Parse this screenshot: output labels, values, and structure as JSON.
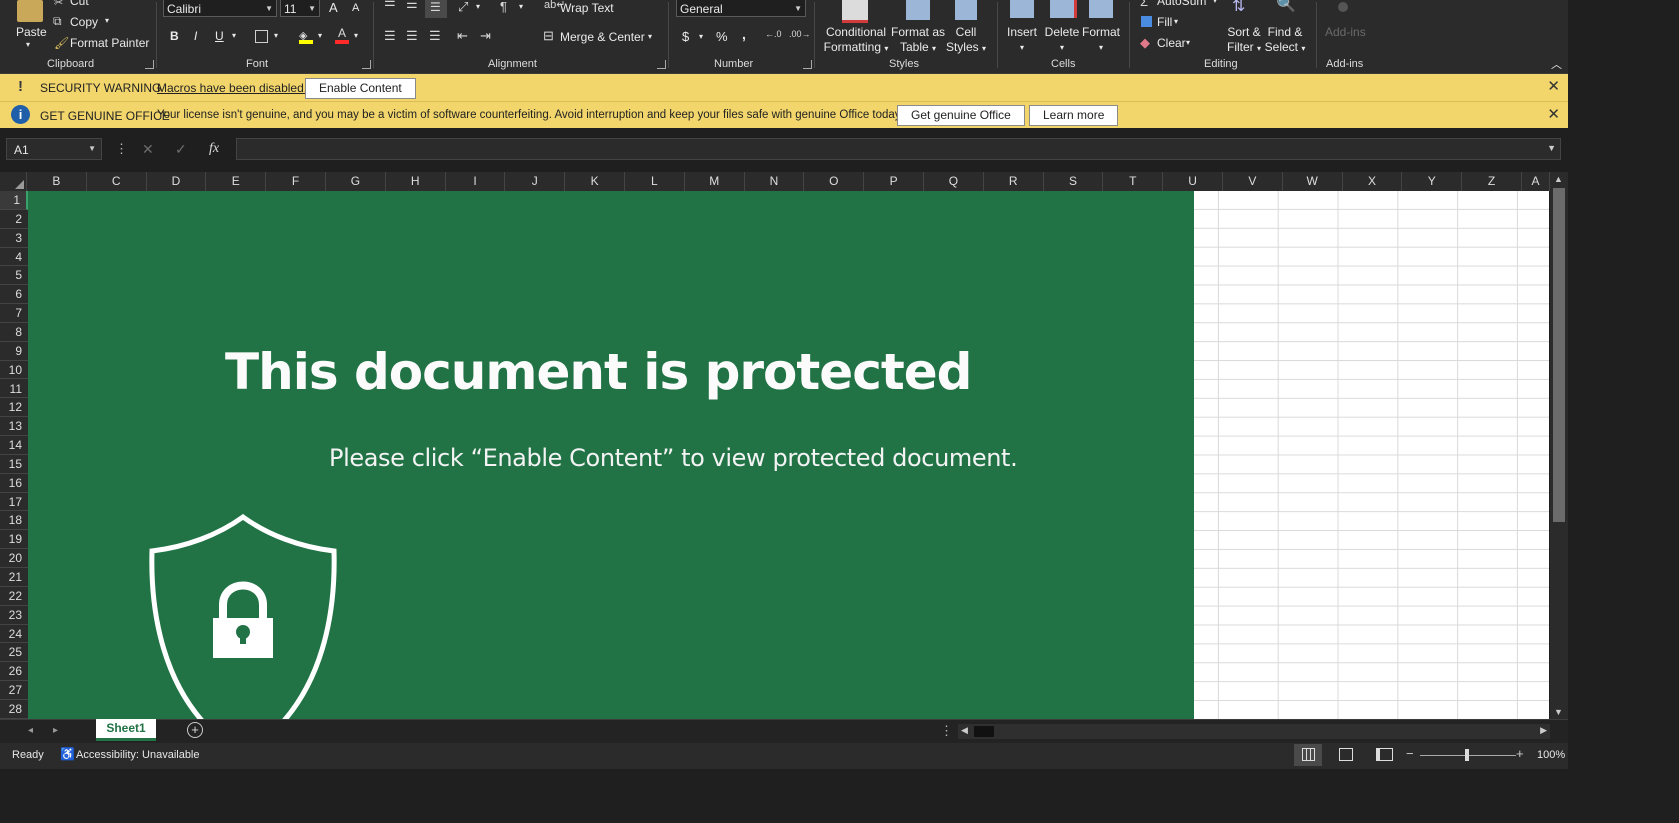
{
  "ribbon": {
    "clipboard": {
      "paste": "Paste",
      "cut": "Cut",
      "copy": "Copy",
      "format_painter": "Format Painter",
      "label": "Clipboard"
    },
    "font": {
      "name": "Calibri",
      "size": "11",
      "bold": "B",
      "italic": "I",
      "underline": "U",
      "grow": "A",
      "shrink": "A",
      "label": "Font"
    },
    "alignment": {
      "wrap_text": "Wrap Text",
      "merge_center": "Merge & Center",
      "label": "Alignment"
    },
    "number": {
      "format": "General",
      "currency": "$",
      "percent": "%",
      "comma": ",",
      "label": "Number"
    },
    "styles": {
      "conditional_line1": "Conditional",
      "conditional_line2": "Formatting",
      "format_table_line1": "Format as",
      "format_table_line2": "Table",
      "cell_styles_line1": "Cell",
      "cell_styles_line2": "Styles",
      "label": "Styles"
    },
    "cells": {
      "insert": "Insert",
      "delete": "Delete",
      "format": "Format",
      "label": "Cells"
    },
    "editing": {
      "autosum": "AutoSum",
      "fill": "Fill",
      "clear": "Clear",
      "sort_line1": "Sort &",
      "sort_line2": "Filter",
      "find_line1": "Find &",
      "find_line2": "Select",
      "label": "Editing"
    },
    "addins": {
      "button": "Add-ins",
      "label": "Add-ins"
    }
  },
  "security_bar": {
    "title": "SECURITY WARNING",
    "message": "Macros have been disabled.",
    "button": "Enable Content"
  },
  "genuine_bar": {
    "title": "GET GENUINE OFFICE",
    "message": "Your license isn't genuine, and you may be a victim of software counterfeiting. Avoid interruption and keep your files safe with genuine Office today.",
    "button1": "Get genuine Office",
    "button2": "Learn more"
  },
  "formula_bar": {
    "name_box": "A1",
    "fx": "fx",
    "value": ""
  },
  "grid": {
    "columns": [
      "B",
      "C",
      "D",
      "E",
      "F",
      "G",
      "H",
      "I",
      "J",
      "K",
      "L",
      "M",
      "N",
      "O",
      "P",
      "Q",
      "R",
      "S",
      "T",
      "U",
      "V",
      "W",
      "X",
      "Y",
      "Z",
      "A"
    ],
    "rows": [
      "1",
      "2",
      "3",
      "4",
      "5",
      "6",
      "7",
      "8",
      "9",
      "10",
      "11",
      "12",
      "13",
      "14",
      "15",
      "16",
      "17",
      "18",
      "19",
      "20",
      "21",
      "22",
      "23",
      "24",
      "25",
      "26",
      "27",
      "28"
    ]
  },
  "banner": {
    "title": "This document is protected",
    "subtitle": "Please click “Enable Content” to view protected document.",
    "color": "#217346"
  },
  "sheets": {
    "active": "Sheet1"
  },
  "status": {
    "ready": "Ready",
    "accessibility": "Accessibility: Unavailable",
    "zoom": "100%"
  }
}
